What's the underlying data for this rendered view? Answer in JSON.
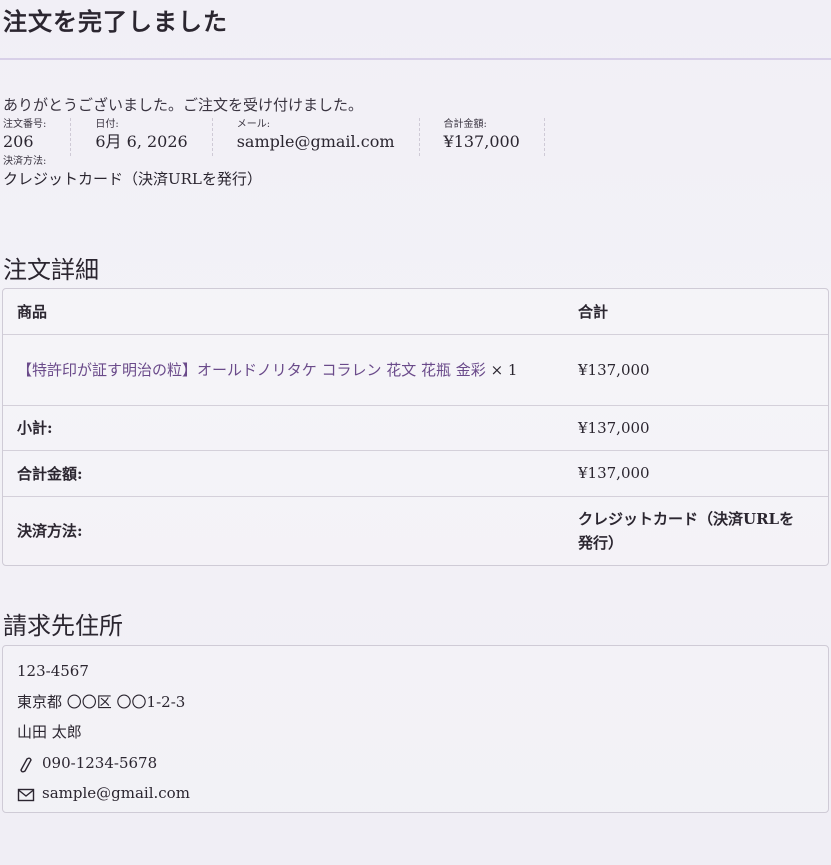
{
  "page": {
    "title": "注文を完了しました",
    "thanks_message": "ありがとうございました。ご注文を受け付けました。"
  },
  "order_overview": {
    "order_number_label": "注文番号:",
    "order_number": "206",
    "date_label": "日付:",
    "date": "6月 6, 2026",
    "email_label": "メール:",
    "email": "sample@gmail.com",
    "total_label": "合計金額:",
    "total": "¥137,000",
    "payment_method_label": "決済方法:",
    "payment_method": "クレジットカード（決済URLを発行）"
  },
  "order_details": {
    "title": "注文詳細",
    "header_product": "商品",
    "header_total": "合計",
    "product_name": "【特許印が証す明治の粒】オールドノリタケ コラレン 花文 花瓶 金彩",
    "product_qty": "× 1",
    "product_total": "¥137,000",
    "subtotal_label": "小計:",
    "subtotal": "¥137,000",
    "total_label": "合計金額:",
    "total": "¥137,000",
    "payment_label": "決済方法:",
    "payment": "クレジットカード（決済URLを発行）"
  },
  "billing_address": {
    "title": "請求先住所",
    "postal_code": "123-4567",
    "address": "東京都 〇〇区 〇〇1-2-3",
    "name": "山田 太郎",
    "phone": "090-1234-5678",
    "email": "sample@gmail.com",
    "phone_icon": "phone-icon",
    "email_icon": "envelope-icon"
  }
}
